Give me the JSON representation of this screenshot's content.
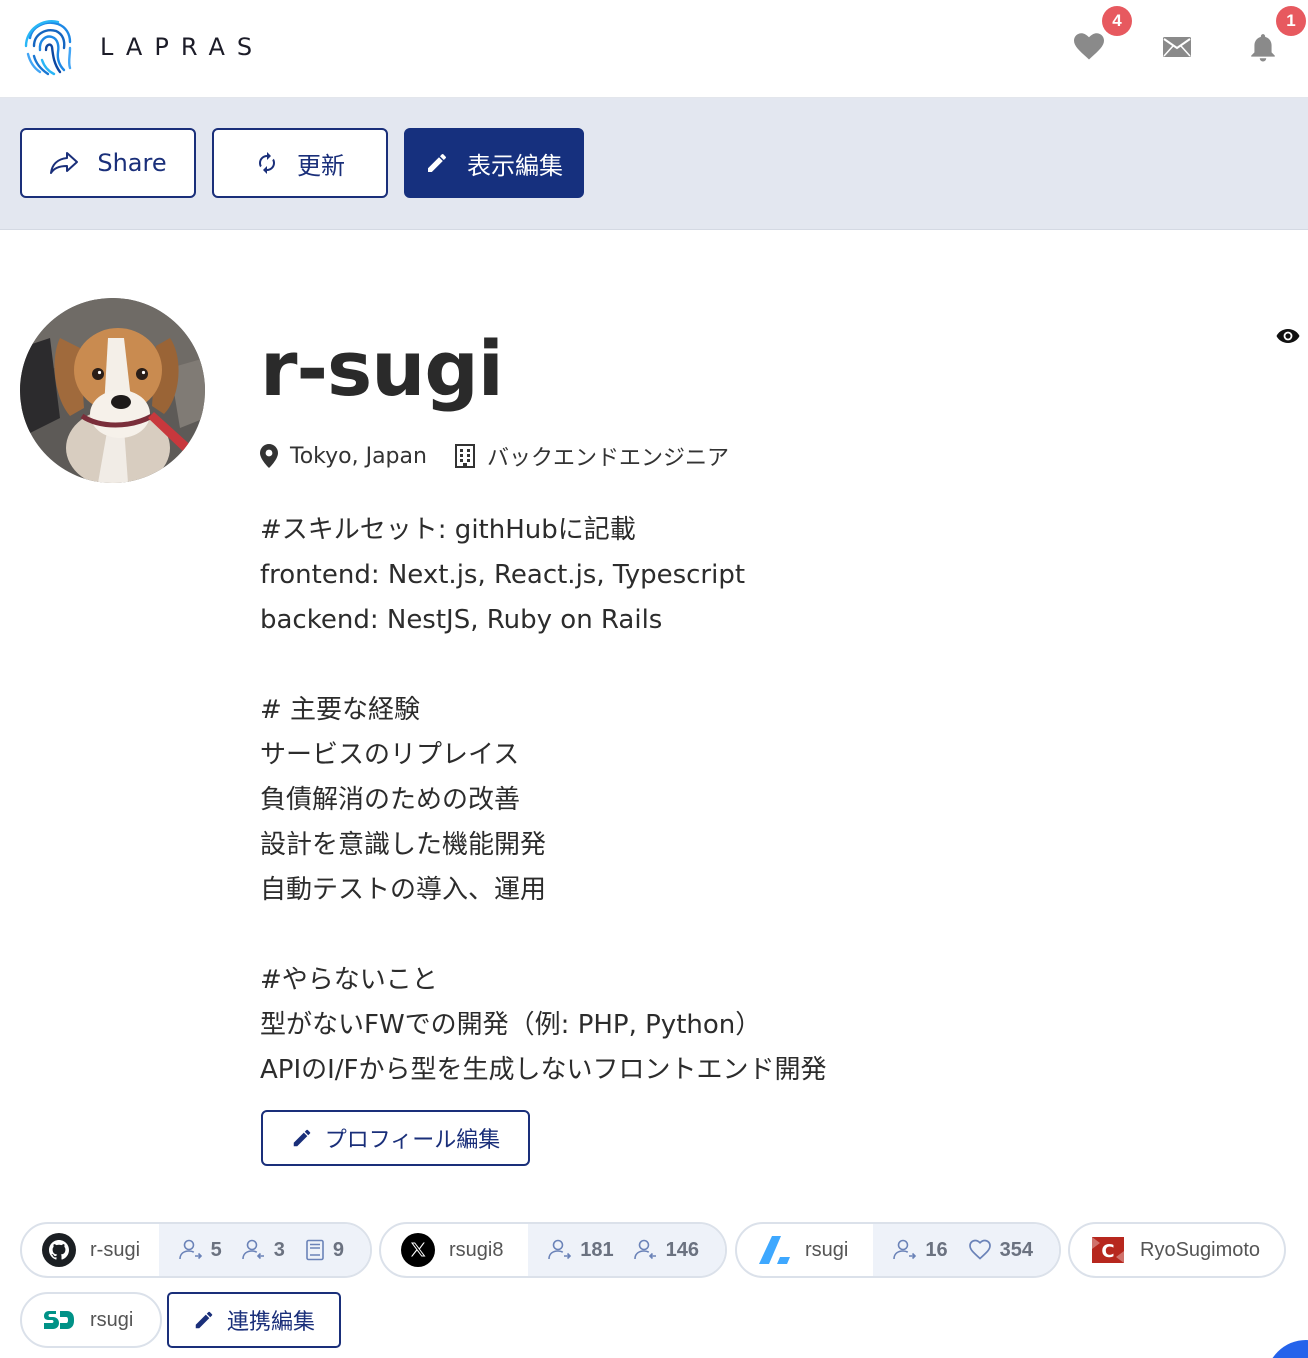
{
  "header": {
    "logo_text": "LAPRAS",
    "icons": [
      {
        "name": "heart-icon",
        "badge": "4"
      },
      {
        "name": "mail-icon",
        "badge": ""
      },
      {
        "name": "bell-icon",
        "badge": "1"
      }
    ]
  },
  "actions": {
    "share_label": "Share",
    "refresh_label": "更新",
    "edit_display_label": "表示編集"
  },
  "profile": {
    "username": "r-sugi",
    "location": "Tokyo, Japan",
    "job_title": "バックエンドエンジニア",
    "bio_lines": [
      "#スキルセット: githHubに記載",
      "frontend: Next.js, React.js, Typescript",
      "backend: NestJS, Ruby on Rails",
      "",
      "# 主要な経験",
      "サービスのリプレイス",
      "負債解消のための改善",
      "設計を意識した機能開発",
      "自動テストの導入、運用",
      "",
      "#やらないこと",
      "型がないFWでの開発（例: PHP, Python）",
      "APIのI/Fから型を生成しないフロントエンド開発"
    ],
    "edit_profile_label": "プロフィール編集"
  },
  "accounts": {
    "github": {
      "name": "r-sugi",
      "followers": "5",
      "following": "3",
      "repos": "9"
    },
    "x": {
      "name": "rsugi8",
      "followers": "181",
      "following": "146"
    },
    "zenn": {
      "name": "rsugi",
      "followers": "16",
      "likes": "354"
    },
    "connpass": {
      "name": "RyoSugimoto"
    },
    "speakerdeck": {
      "name": "rsugi"
    },
    "edit_links_label": "連携編集"
  },
  "colors": {
    "brand_navy": "#16307e",
    "badge_red": "#e7595f",
    "action_bar_bg": "#e3e7f0"
  }
}
